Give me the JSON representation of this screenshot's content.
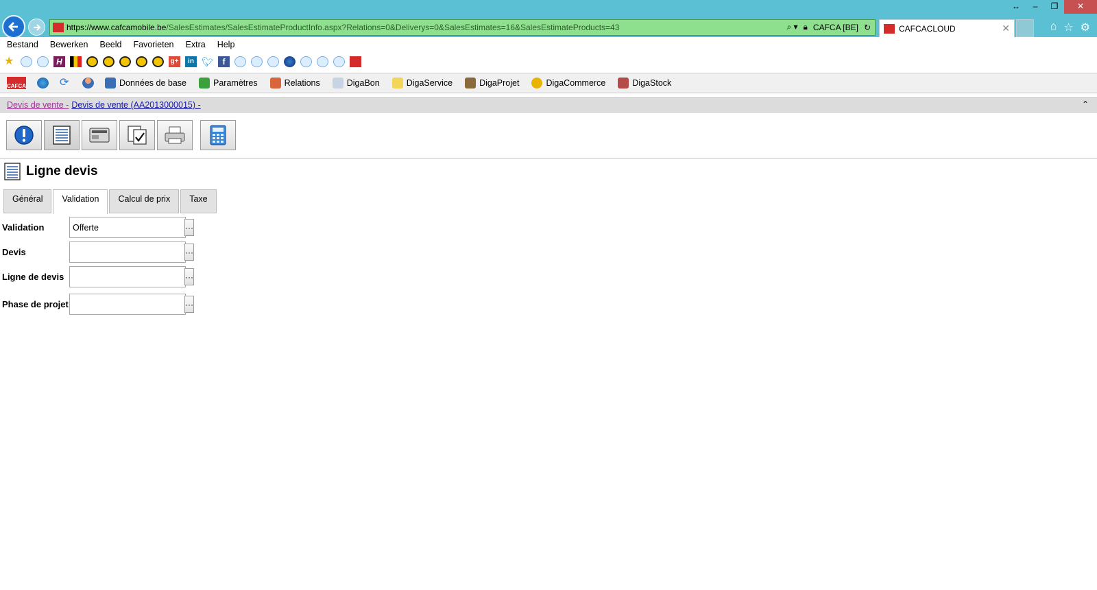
{
  "browser": {
    "url_host": "https://www.cafcamobile.be",
    "url_path": "/SalesEstimates/SalesEstimateProductInfo.aspx?Relations=0&Deliverys=0&SalesEstimates=16&SalesEstimateProducts=43",
    "site_identity": "CAFCA [BE]",
    "tab_title": "CAFCACLOUD"
  },
  "menu": [
    "Bestand",
    "Bewerken",
    "Beeld",
    "Favorieten",
    "Extra",
    "Help"
  ],
  "app_toolbar": {
    "logo_text": "CAFCA",
    "items": [
      "Données de base",
      "Paramètres",
      "Relations",
      "DigaBon",
      "DigaService",
      "DigaProjet",
      "DigaCommerce",
      "DigaStock"
    ]
  },
  "breadcrumb": {
    "parent": "Devis de vente -",
    "current": "Devis de vente (AA2013000015) -"
  },
  "page": {
    "title": "Ligne devis"
  },
  "tabs": [
    "Général",
    "Validation",
    "Calcul de prix",
    "Taxe"
  ],
  "active_tab": "Validation",
  "form": {
    "button_label": "···",
    "fields": [
      {
        "label": "Validation",
        "value": "Offerte"
      },
      {
        "label": "Devis",
        "value": ""
      },
      {
        "label": "Ligne de devis",
        "value": ""
      },
      {
        "label": "Phase de projet",
        "value": ""
      }
    ]
  }
}
